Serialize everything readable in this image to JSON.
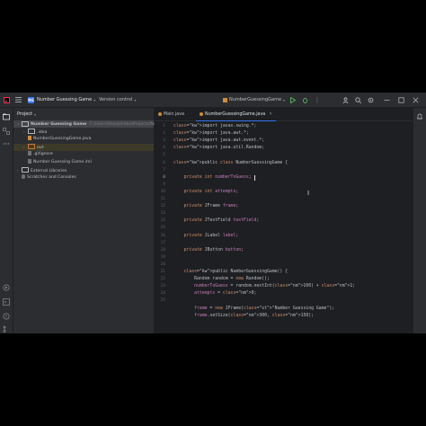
{
  "titlebar": {
    "project_badge": "NG",
    "project_name": "Number Guessing Game",
    "vcs_label": "Version control",
    "run_config": "NumberGuessingGame"
  },
  "project_panel": {
    "title": "Project",
    "tree": [
      {
        "label": "Number Guessing Game",
        "extra": "C:\\Users\\Sharpe\\IdeaProjects\\Nu",
        "indent": 0,
        "icon": "folder",
        "arrow": "down"
      },
      {
        "label": ".idea",
        "extra": "",
        "indent": 1,
        "icon": "folder",
        "arrow": "right"
      },
      {
        "label": "NumberGuessingGame.java",
        "extra": "",
        "indent": 1,
        "icon": "java-file",
        "arrow": ""
      },
      {
        "label": "out",
        "extra": "",
        "indent": 1,
        "icon": "folder-orange",
        "arrow": "right"
      },
      {
        "label": ".gitignore",
        "extra": "",
        "indent": 1,
        "icon": "file",
        "arrow": ""
      },
      {
        "label": "Number Guessing Game.iml",
        "extra": "",
        "indent": 1,
        "icon": "file",
        "arrow": ""
      },
      {
        "label": "External Libraries",
        "extra": "",
        "indent": 0,
        "icon": "library",
        "arrow": "right"
      },
      {
        "label": "Scratches and Consoles",
        "extra": "",
        "indent": 0,
        "icon": "scratch",
        "arrow": ""
      }
    ]
  },
  "editor": {
    "tabs": [
      {
        "label": "Main.java",
        "active": false
      },
      {
        "label": "NumberGuessingGame.java",
        "active": true
      }
    ],
    "line_numbers": [
      "1",
      "2",
      "3",
      "4",
      "5",
      "6",
      "7",
      "8",
      "9",
      "10",
      "11",
      "12",
      "13",
      "14",
      "15",
      "16",
      "17",
      "18",
      "19",
      "20",
      "21",
      "22",
      "23",
      "24",
      "25"
    ],
    "lines": [
      "import javax.swing.*;",
      "import java.awt.*;",
      "import java.awt.event.*;",
      "import java.util.Random;",
      "",
      "public class NumberGuessingGame {",
      "",
      "    private int numberToGuess;",
      "",
      "    private int attempts;",
      "",
      "    private JFrame frame;",
      "",
      "    private JTextField textField;",
      "",
      "    private JLabel label;",
      "",
      "    private JButton button;",
      "",
      "",
      "    public NumberGuessingGame() {",
      "        Random random = new Random();",
      "        numberToGuess = random.nextInt(100) + 1;",
      "        attempts = 0;",
      "",
      "        frame = new JFrame(\"Number Guessing Game\");",
      "        frame.setSize(300, 150);"
    ]
  }
}
